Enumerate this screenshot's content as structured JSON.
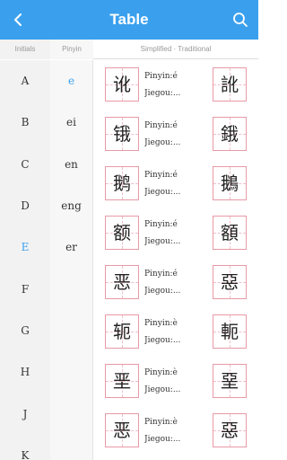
{
  "appbar": {
    "title": "Table",
    "back_icon": "chevron-left-icon",
    "search_icon": "search-icon",
    "background": "#3aa0ee"
  },
  "headers": {
    "initials": "Initials",
    "pinyin": "Pinyin",
    "characters": "Simplified · Traditional"
  },
  "initials": [
    "A",
    "B",
    "C",
    "D",
    "E",
    "F",
    "G",
    "H",
    "J",
    "K"
  ],
  "initials_active": "E",
  "pinyin": [
    "e",
    "ei",
    "en",
    "eng",
    "er"
  ],
  "pinyin_active": "e",
  "accent_color": "#3aa0ee",
  "grid_color": "#e79aa6",
  "characters": [
    {
      "simplified": "讹",
      "traditional": "訛",
      "pinyin": "Pinyin:é",
      "jiegou": "Jiegou:..."
    },
    {
      "simplified": "锇",
      "traditional": "鋨",
      "pinyin": "Pinyin:é",
      "jiegou": "Jiegou:..."
    },
    {
      "simplified": "鹅",
      "traditional": "鵝",
      "pinyin": "Pinyin:é",
      "jiegou": "Jiegou:..."
    },
    {
      "simplified": "额",
      "traditional": "額",
      "pinyin": "Pinyin:é",
      "jiegou": "Jiegou:..."
    },
    {
      "simplified": "恶",
      "traditional": "惡",
      "pinyin": "Pinyin:é",
      "jiegou": "Jiegou:..."
    },
    {
      "simplified": "轭",
      "traditional": "軛",
      "pinyin": "Pinyin:è",
      "jiegou": "Jiegou:..."
    },
    {
      "simplified": "垩",
      "traditional": "堊",
      "pinyin": "Pinyin:è",
      "jiegou": "Jiegou:..."
    },
    {
      "simplified": "恶",
      "traditional": "惡",
      "pinyin": "Pinyin:è",
      "jiegou": "Jiegou:..."
    }
  ]
}
